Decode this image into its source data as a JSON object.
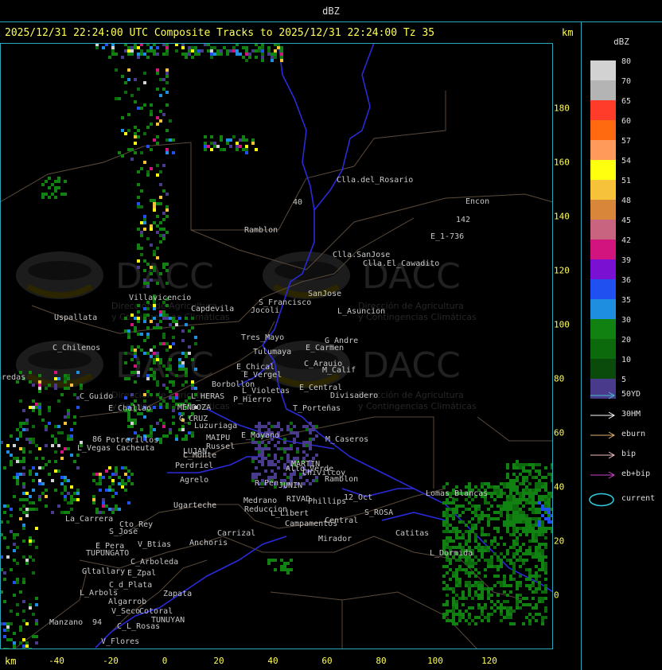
{
  "window": {
    "title": "dBZ"
  },
  "header": {
    "title": "2025/12/31 22:24:00 UTC Composite Tracks to 2025/12/31 22:24:00 Tz 35",
    "km_label": "km"
  },
  "x_axis": {
    "label": "km",
    "ticks": [
      "-40",
      "-20",
      "0",
      "20",
      "40",
      "60",
      "80",
      "100",
      "120"
    ]
  },
  "y_axis": {
    "ticks": [
      "180",
      "160",
      "140",
      "120",
      "100",
      "80",
      "60",
      "40",
      "20",
      "0"
    ]
  },
  "legend": {
    "title": "dBZ",
    "scale": [
      {
        "label": "80",
        "color": "#d2d2d2"
      },
      {
        "label": "70",
        "color": "#b4b4b4"
      },
      {
        "label": "65",
        "color": "#ff3b2a"
      },
      {
        "label": "60",
        "color": "#ff6a10"
      },
      {
        "label": "57",
        "color": "#ff9a5a"
      },
      {
        "label": "54",
        "color": "#ffff10"
      },
      {
        "label": "51",
        "color": "#f5c23a"
      },
      {
        "label": "48",
        "color": "#d8873a"
      },
      {
        "label": "45",
        "color": "#c86480"
      },
      {
        "label": "42",
        "color": "#d2147f"
      },
      {
        "label": "39",
        "color": "#7a10d2"
      },
      {
        "label": "36",
        "color": "#2050f0"
      },
      {
        "label": "35",
        "color": "#1e8fe0"
      },
      {
        "label": "30",
        "color": "#118211"
      },
      {
        "label": "20",
        "color": "#0c6a0c"
      },
      {
        "label": "10",
        "color": "#0a4a0a"
      },
      {
        "label": "5",
        "color": "#4a3a8c"
      }
    ],
    "tracks": [
      {
        "label": "50YD",
        "color": "#40c0d0"
      },
      {
        "label": "30HM",
        "color": "#ffffff"
      },
      {
        "label": "eburn",
        "color": "#e0b070"
      },
      {
        "label": "bip",
        "color": "#f0c0c0"
      },
      {
        "label": "eb+bip",
        "color": "#d040d0"
      }
    ],
    "current": {
      "label": "current",
      "color": "#30d0e0"
    }
  },
  "watermark": {
    "text": "DACC",
    "subtitle_1": "Dirección de Agricultura",
    "subtitle_2": "y Contingencias Climáticas"
  },
  "places": [
    "Clla.del_Rosario",
    "Encon",
    "142",
    "Ramblon",
    "E_1-736",
    "Clla.SanJose",
    "Clla.El_Cawadito",
    "Villavicencio",
    "Capdevila",
    "S_Francisco",
    "SanJose",
    "Jocoli",
    "L_Asuncion",
    "Uspallata",
    "Tres_Mayo",
    "G_Andre",
    "Tulumaya",
    "E_Carmen",
    "C_Chilenos",
    "E_Chical",
    "C_Arauio",
    "E_Vergel",
    "M_Calif",
    "Paredas",
    "Borbollon",
    "E_Central",
    "L_Violetas",
    "Divisadero",
    "C_Guido",
    "L_HERAS",
    "P_Hierro",
    "E_Challao",
    "MENDOZA",
    "T_Porteñas",
    "G_CRUZ",
    "Luzuriaga",
    "E_Moyano",
    "Potrerillos",
    "MAIPU",
    "Russel",
    "M_Caseros",
    "L_Vegas",
    "Cacheuta",
    "LUJAN",
    "C_Monte",
    "Perdriel",
    "MARTIN",
    "Alto_Verde",
    "Chivilcoy",
    "Ramblon",
    "Agrelo",
    "R_Pen",
    "JUNIN",
    "Ugarteche",
    "Medrano",
    "RIVAD",
    "Phillips",
    "12_Oct",
    "Lomas_Blancas",
    "Reduccion",
    "L_Libert",
    "S_ROSA",
    "La_Carrera",
    "Cto_Rey",
    "Campamentos",
    "Central",
    "S_Jose",
    "Carrizal",
    "Catitas",
    "E_Pera",
    "V_Btias",
    "Anchoris",
    "TUPUNGATO",
    "Mirador",
    "L_Dormida",
    "C_Arboleda",
    "Gltallary",
    "E_Zpal",
    "C_d_Plata",
    "L_Arbols",
    "Zapata",
    "Algarrob",
    "V_Seco",
    "Cotoral",
    "TUNUYAN",
    "Manzano",
    "C_L_Rosas",
    "V_Flores",
    "94",
    "86",
    "40"
  ]
}
